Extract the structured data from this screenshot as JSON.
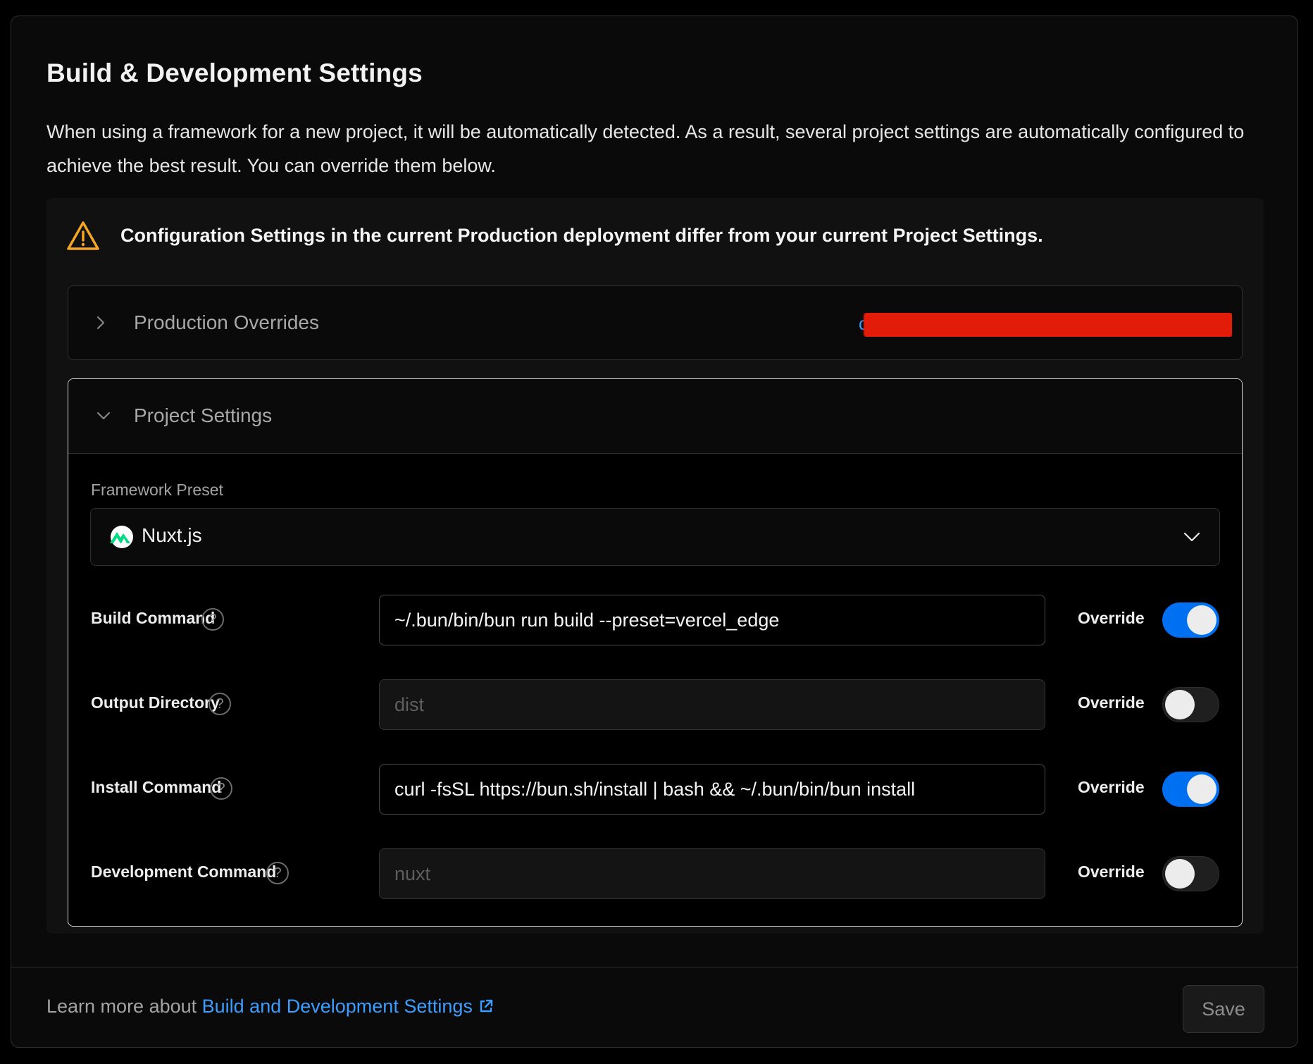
{
  "card": {
    "title": "Build & Development Settings",
    "description": "When using a framework for a new project, it will be automatically detected. As a result, several project settings are automatically configured to achieve the best result. You can override them below."
  },
  "warning": {
    "icon": "warning-triangle-icon",
    "text": "Configuration Settings in the current Production deployment differ from your current Project Settings."
  },
  "production_overrides": {
    "label": "Production Overrides",
    "expanded": false,
    "link_text": "c"
  },
  "project_settings": {
    "label": "Project Settings",
    "expanded": true,
    "framework_preset": {
      "label": "Framework Preset",
      "value": "Nuxt.js",
      "icon": "nuxt-logo-icon"
    },
    "rows": [
      {
        "label": "Build Command",
        "value": "~/.bun/bin/bun run build --preset=vercel_edge",
        "placeholder": "",
        "override_label": "Override",
        "override": true
      },
      {
        "label": "Output Directory",
        "value": "",
        "placeholder": "dist",
        "override_label": "Override",
        "override": false
      },
      {
        "label": "Install Command",
        "value": "curl -fsSL https://bun.sh/install | bash && ~/.bun/bin/bun install",
        "placeholder": "",
        "override_label": "Override",
        "override": true
      },
      {
        "label": "Development Command",
        "value": "",
        "placeholder": "nuxt",
        "override_label": "Override",
        "override": false
      }
    ]
  },
  "footer": {
    "prefix": "Learn more about ",
    "link_text": "Build and Development Settings",
    "save_label": "Save"
  },
  "colors": {
    "accent": "#0070f3",
    "link": "#3b9dff",
    "warning": "#f5a623",
    "nuxt": "#00dc82"
  }
}
